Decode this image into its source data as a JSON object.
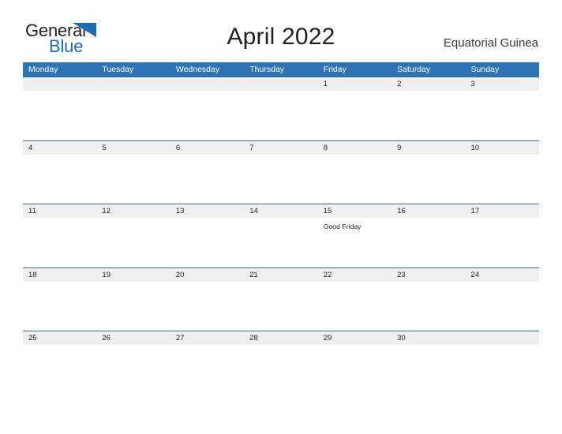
{
  "brand": {
    "name_part1": "General",
    "name_part2": "Blue",
    "flag_icon": "blue-triangle-flag",
    "color_dark": "#231f20",
    "color_blue": "#1b6cb0"
  },
  "header": {
    "title": "April 2022",
    "country": "Equatorial Guinea"
  },
  "theme": {
    "header_blue": "#2e74b5",
    "row_divider_blue": "#2e6da4",
    "day_band_gray": "#f0f0f0",
    "page_background": "#ffffff"
  },
  "calendar": {
    "weekdays": [
      "Monday",
      "Tuesday",
      "Wednesday",
      "Thursday",
      "Friday",
      "Saturday",
      "Sunday"
    ],
    "weeks": [
      [
        {
          "date": "",
          "event": ""
        },
        {
          "date": "",
          "event": ""
        },
        {
          "date": "",
          "event": ""
        },
        {
          "date": "",
          "event": ""
        },
        {
          "date": "1",
          "event": ""
        },
        {
          "date": "2",
          "event": ""
        },
        {
          "date": "3",
          "event": ""
        }
      ],
      [
        {
          "date": "4",
          "event": ""
        },
        {
          "date": "5",
          "event": ""
        },
        {
          "date": "6",
          "event": ""
        },
        {
          "date": "7",
          "event": ""
        },
        {
          "date": "8",
          "event": ""
        },
        {
          "date": "9",
          "event": ""
        },
        {
          "date": "10",
          "event": ""
        }
      ],
      [
        {
          "date": "11",
          "event": ""
        },
        {
          "date": "12",
          "event": ""
        },
        {
          "date": "13",
          "event": ""
        },
        {
          "date": "14",
          "event": ""
        },
        {
          "date": "15",
          "event": "Good Friday"
        },
        {
          "date": "16",
          "event": ""
        },
        {
          "date": "17",
          "event": ""
        }
      ],
      [
        {
          "date": "18",
          "event": ""
        },
        {
          "date": "19",
          "event": ""
        },
        {
          "date": "20",
          "event": ""
        },
        {
          "date": "21",
          "event": ""
        },
        {
          "date": "22",
          "event": ""
        },
        {
          "date": "23",
          "event": ""
        },
        {
          "date": "24",
          "event": ""
        }
      ],
      [
        {
          "date": "25",
          "event": ""
        },
        {
          "date": "26",
          "event": ""
        },
        {
          "date": "27",
          "event": ""
        },
        {
          "date": "28",
          "event": ""
        },
        {
          "date": "29",
          "event": ""
        },
        {
          "date": "30",
          "event": ""
        },
        {
          "date": "",
          "event": ""
        }
      ]
    ]
  }
}
